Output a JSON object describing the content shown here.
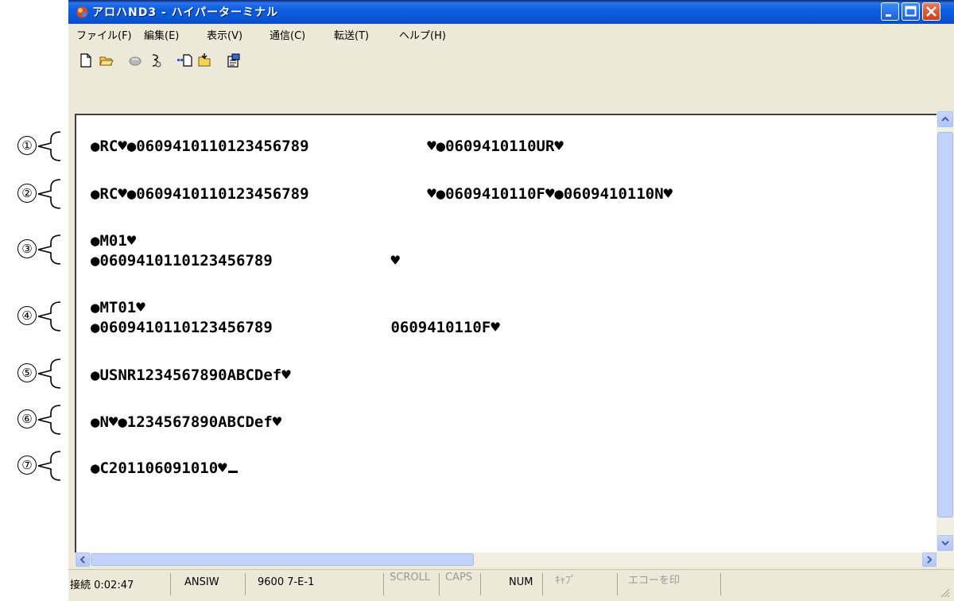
{
  "annotations": [
    "①",
    "②",
    "③",
    "④",
    "⑤",
    "⑥",
    "⑦"
  ],
  "window": {
    "title": "アロハND3 - ハイパーターミナル",
    "icon": "hyperterminal-icon"
  },
  "menu": [
    "ファイル(F)",
    "編集(E)",
    "表示(V)",
    "通信(C)",
    "転送(T)",
    "ヘルプ(H)"
  ],
  "toolbar": [
    "new-icon",
    "open-icon",
    "connect-icon",
    "disconnect-icon",
    "send-icon",
    "receive-icon",
    "properties-icon"
  ],
  "terminal_lines": [
    "●RC♥●0609410110123456789             ♥●0609410110UR♥",
    "●RC♥●0609410110123456789             ♥●0609410110F♥●0609410110N♥",
    "●M01♥",
    "●0609410110123456789             ♥",
    "●MT01♥",
    "●0609410110123456789             0609410110F♥",
    "●USNR1234567890ABCDef♥",
    "●N♥●1234567890ABCDef♥",
    "●C201106091010♥"
  ],
  "status": {
    "connection": "接続 0:02:47",
    "emulation": "ANSIW",
    "settings": "9600 7-E-1",
    "scroll": "SCROLL",
    "caps": "CAPS",
    "num": "NUM",
    "capture": "ｷｬﾌﾟ",
    "echo": "エコーを印"
  }
}
